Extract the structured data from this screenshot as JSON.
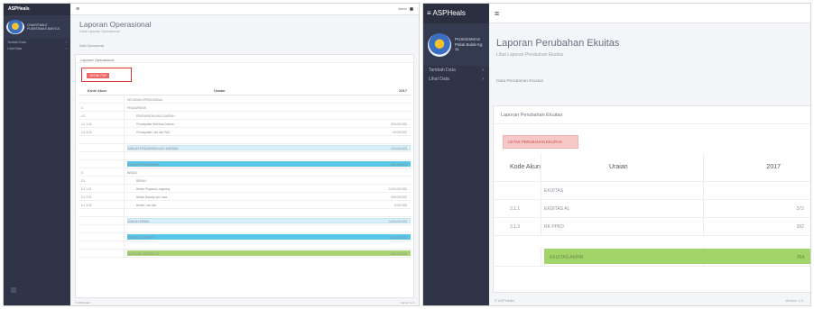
{
  "left": {
    "brand": "ASPHeals",
    "user": "CHAIRITABLE PUSKESMAS BANTUL",
    "nav": [
      {
        "label": "Tambah Data",
        "arrow": "›"
      },
      {
        "label": "Lihat Data",
        "arrow": "›"
      }
    ],
    "topbar": {
      "menu_icon": "≡",
      "user_label": "Admin"
    },
    "page_title": "Laporan Operasional",
    "page_subtitle": "Lihat Laporan Operasional",
    "breadcrumb": "Data Operasional",
    "panel_title": "Laporan Operasional",
    "button": "CETAK PDF",
    "table": {
      "headers": [
        "Kode Akun",
        "Uraian",
        "2017"
      ],
      "rows": [
        {
          "kode": "",
          "uraian": "KEGIATAN OPERASIONAL",
          "nilai": "",
          "style": "plain"
        },
        {
          "kode": "4",
          "uraian": "PENDAPATAN",
          "nilai": "",
          "style": "plain"
        },
        {
          "kode": "4.1",
          "uraian": "PENDAPATAN ASLI DAERAH",
          "nilai": "",
          "style": "sub"
        },
        {
          "kode": "4.1.1.04",
          "uraian": "Pendapatan Retribusi Daerah",
          "nilai": "000.000.000",
          "style": "sub"
        },
        {
          "kode": "4.1.4.16",
          "uraian": "Pendapatan Lain-lain PAD",
          "nilai": "00.000.000",
          "style": "sub"
        },
        {
          "kode": "",
          "uraian": "",
          "nilai": "",
          "style": "plain"
        },
        {
          "kode": "",
          "uraian": "JUMLAH PENDAPATAN ASLI DAERAH",
          "nilai": "000.000.000",
          "style": "lightblue"
        },
        {
          "kode": "",
          "uraian": "",
          "nilai": "",
          "style": "plain"
        },
        {
          "kode": "",
          "uraian": "JUMLAH PENDAPATAN",
          "nilai": "000.000.000",
          "style": "blue"
        },
        {
          "kode": "5",
          "uraian": "BEBAN",
          "nilai": "",
          "style": "plain"
        },
        {
          "kode": "5.1",
          "uraian": "BEBAN",
          "nilai": "",
          "style": "sub"
        },
        {
          "kode": "5.1.1.01",
          "uraian": "Beban Pegawai Langsung",
          "nilai": "0.000.000.000",
          "style": "sub"
        },
        {
          "kode": "5.1.2.02",
          "uraian": "Beban Barang dan Jasa",
          "nilai": "000.000.000",
          "style": "sub"
        },
        {
          "kode": "5.1.3.03",
          "uraian": "Beban Lain-lain",
          "nilai": "0.000.000",
          "style": "sub"
        },
        {
          "kode": "",
          "uraian": "",
          "nilai": "",
          "style": "plain"
        },
        {
          "kode": "",
          "uraian": "JUMLAH BEBAN",
          "nilai": "0.000.000.000",
          "style": "lightblue"
        },
        {
          "kode": "",
          "uraian": "",
          "nilai": "",
          "style": "plain"
        },
        {
          "kode": "",
          "uraian": "SURPLUS / DEFISIT",
          "nilai": "000.000.000",
          "style": "blue"
        },
        {
          "kode": "",
          "uraian": "",
          "nilai": "",
          "style": "plain"
        },
        {
          "kode": "",
          "uraian": "SURPLUS / DEFISIT LO",
          "nilai": "000.000.000",
          "style": "green"
        }
      ]
    },
    "footer_left": "© ASPHeals",
    "footer_right": "Version 1.0"
  },
  "right": {
    "brand": "≡ ASPHeals",
    "user": "PUSKESMAS Pakai Bulak Kg 11",
    "nav": [
      {
        "label": "Tambah Data",
        "arrow": "›"
      },
      {
        "label": "Lihat Data",
        "arrow": "›"
      }
    ],
    "topbar": {
      "menu_icon": "≡"
    },
    "page_title": "Laporan Perubahan Ekuitas",
    "page_subtitle": "Lihat Laporan Perubahan Ekuitas",
    "breadcrumb": "Data Perubahan Ekuitas",
    "panel_title": "Laporan Perubahan Ekuitas",
    "button": "CETAK PERUBAHAN EKUITAS",
    "table": {
      "headers": [
        "Kode Akun",
        "Uraian",
        "2017"
      ],
      "rows": [
        {
          "kode": "",
          "uraian": "EKUITAS",
          "nilai": "",
          "style": "row"
        },
        {
          "kode": "3.1.1",
          "uraian": "EKUITAS AL",
          "nilai": "372",
          "style": "row"
        },
        {
          "kode": "3.1.2",
          "uraian": "RK PPKD",
          "nilai": "392",
          "style": "row"
        },
        {
          "kode": "",
          "uraian": "",
          "nilai": "",
          "style": "gap"
        },
        {
          "kode": "",
          "uraian": "EKUITAS AKHIR",
          "nilai": "764",
          "style": "green"
        }
      ]
    },
    "footer_left": "© ASPHeals",
    "footer_right": "Version 1.0"
  }
}
